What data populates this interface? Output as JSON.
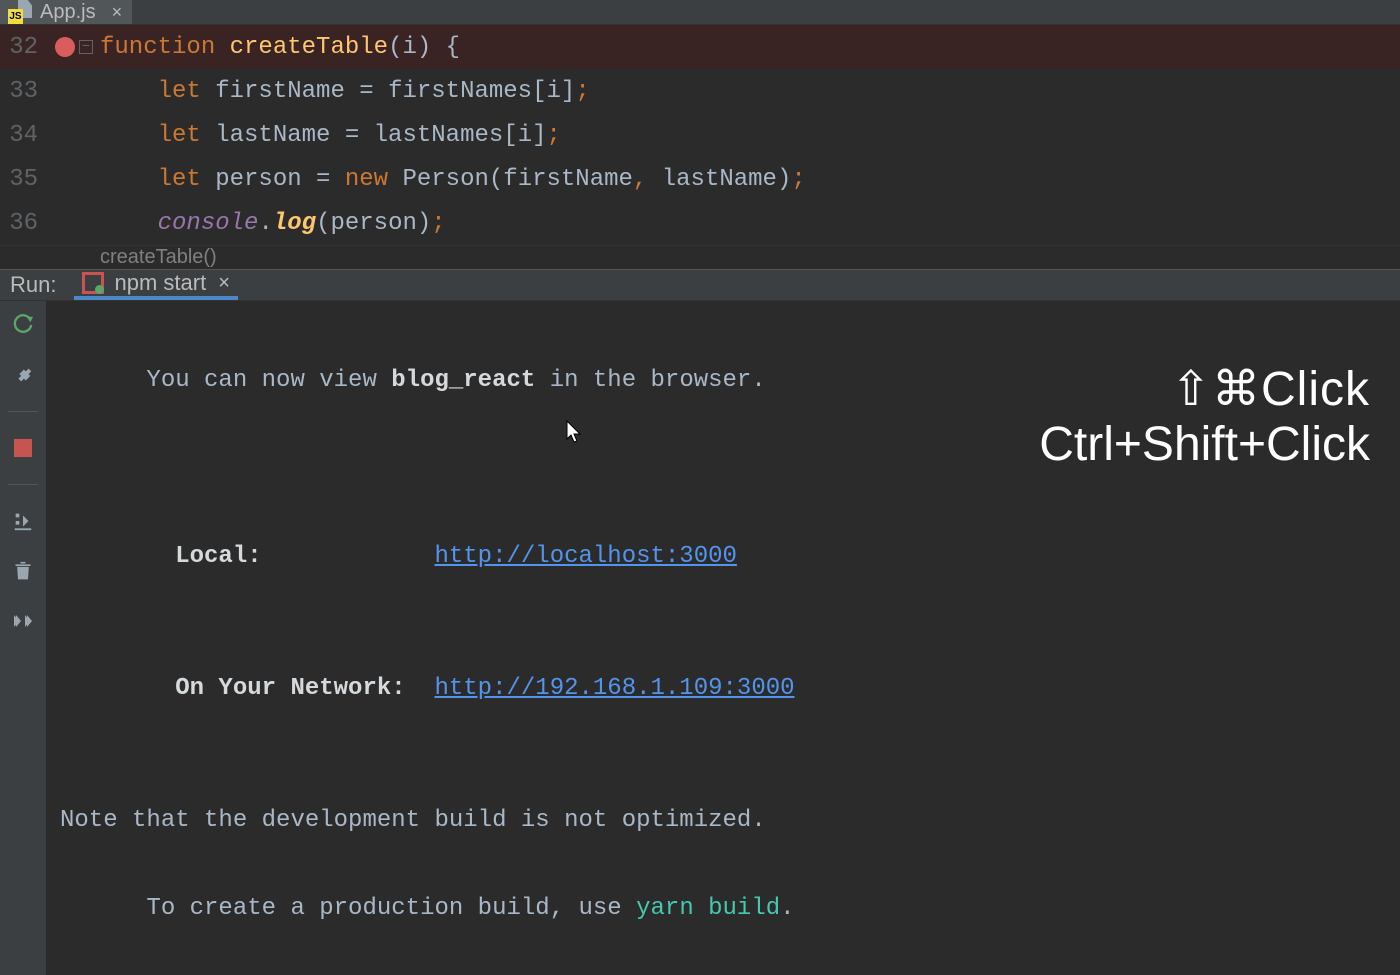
{
  "tab": {
    "filename": "App.js"
  },
  "editor": {
    "lines": [
      {
        "num": "32",
        "bp": true,
        "tokens": [
          {
            "t": "function ",
            "c": "kw"
          },
          {
            "t": "createTable",
            "c": "fn"
          },
          {
            "t": "(",
            "c": "punc"
          },
          {
            "t": "i",
            "c": "ident"
          },
          {
            "t": ") {",
            "c": "punc"
          }
        ]
      },
      {
        "num": "33",
        "bp": false,
        "indent": "    ",
        "tokens": [
          {
            "t": "let ",
            "c": "kw"
          },
          {
            "t": "firstName ",
            "c": "ident"
          },
          {
            "t": "= ",
            "c": "punc"
          },
          {
            "t": "firstNames",
            "c": "ident"
          },
          {
            "t": "[",
            "c": "punc"
          },
          {
            "t": "i",
            "c": "ident"
          },
          {
            "t": "]",
            "c": "punc"
          },
          {
            "t": ";",
            "c": "comma"
          }
        ]
      },
      {
        "num": "34",
        "bp": false,
        "indent": "    ",
        "tokens": [
          {
            "t": "let ",
            "c": "kw"
          },
          {
            "t": "lastName ",
            "c": "ident"
          },
          {
            "t": "= ",
            "c": "punc"
          },
          {
            "t": "lastNames",
            "c": "ident"
          },
          {
            "t": "[",
            "c": "punc"
          },
          {
            "t": "i",
            "c": "ident"
          },
          {
            "t": "]",
            "c": "punc"
          },
          {
            "t": ";",
            "c": "comma"
          }
        ]
      },
      {
        "num": "35",
        "bp": false,
        "indent": "    ",
        "tokens": [
          {
            "t": "let ",
            "c": "kw"
          },
          {
            "t": "person ",
            "c": "ident"
          },
          {
            "t": "= ",
            "c": "punc"
          },
          {
            "t": "new ",
            "c": "kw"
          },
          {
            "t": "Person",
            "c": "ident"
          },
          {
            "t": "(",
            "c": "punc"
          },
          {
            "t": "firstName",
            "c": "ident"
          },
          {
            "t": ", ",
            "c": "comma"
          },
          {
            "t": "lastName",
            "c": "ident"
          },
          {
            "t": ")",
            "c": "punc"
          },
          {
            "t": ";",
            "c": "comma"
          }
        ]
      },
      {
        "num": "36",
        "bp": false,
        "indent": "    ",
        "tokens": [
          {
            "t": "console",
            "c": "prop-italic"
          },
          {
            "t": ".",
            "c": "punc"
          },
          {
            "t": "log",
            "c": "prop-bold"
          },
          {
            "t": "(",
            "c": "punc"
          },
          {
            "t": "person",
            "c": "ident"
          },
          {
            "t": ")",
            "c": "punc"
          },
          {
            "t": ";",
            "c": "comma"
          }
        ]
      }
    ],
    "breadcrumb": "createTable()"
  },
  "run": {
    "panel_label": "Run:",
    "tab_label": "npm start",
    "console": {
      "line1_pre": "You can now view ",
      "line1_bold": "blog_react",
      "line1_post": " in the browser.",
      "local_label": "  Local:            ",
      "local_url": "http://localhost:3000",
      "net_label": "  On Your Network:  ",
      "net_url": "http://192.168.1.109:3000",
      "note1": "Note that the development build is not optimized.",
      "note2_pre": "To create a production build, use ",
      "note2_cmd": "yarn build",
      "note2_post": "."
    }
  },
  "overlay": {
    "mac": "⇧⌘Click",
    "win": "Ctrl+Shift+Click"
  }
}
